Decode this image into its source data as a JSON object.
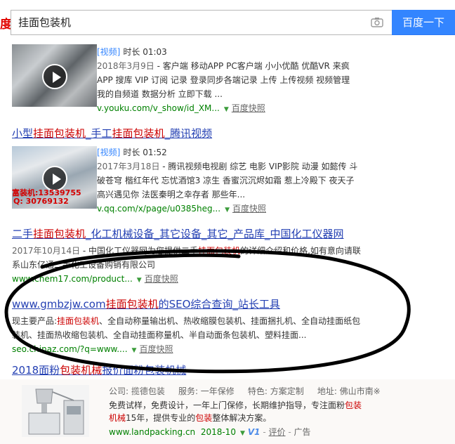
{
  "search": {
    "logo_fragment": "度",
    "query": "挂面包装机",
    "button": "百度一下"
  },
  "results": [
    {
      "tag": "[视频]",
      "duration": "时长 01:03",
      "date": "2018年3月9日",
      "line1": " - 客户端 移动APP PC客户端 小小优酷 优酷VR 来疯",
      "line2": "APP 搜库 VIP 订阅 记录 登录同步各端记录 上传 上传视频 视频管理",
      "line3": "我的自频道 数据分析 立即下载 ...",
      "url": "v.youku.com/v_show/id_XM...",
      "snapshot": "百度快照"
    },
    {
      "title_a": "小型",
      "title_em1": "挂面包装机",
      "title_b": "_手工",
      "title_em2": "挂面包装机",
      "title_c": "_腾讯视频",
      "tag": "[视频]",
      "duration": "时长 01:52",
      "date": "2017年3月18日",
      "line1": " - 腾讯视频电视剧 综艺 电影 VIP影院 动漫 如懿传 斗",
      "line2": "破苍穹 楷红年代 忘忧酒馆3 凉生 香蜜沉沉烬如霜 惹上冷殿下 夜天子",
      "line3": "高兴遇见你 法医秦明之幸存者 那些年...",
      "url": "v.qq.com/x/page/u0385heg...",
      "snapshot": "百度快照",
      "thumb_text": "富装机:13539755",
      "thumb_text2": "Q: 30769132"
    },
    {
      "title_a": "二手",
      "title_em1": "挂面包装机",
      "title_b": "_化工机械设备_其它设备_其它_产品库_中国化工仪器网",
      "date": "2017年10月14日",
      "abs_a": " - 中国化工仪器网为您提供二手",
      "abs_em": "挂面包装机",
      "abs_b": "的详细介绍和价格,如有意向请联",
      "abs_line2": "系山东亿通二手化工设备购销有限公司",
      "url": "www.chem17.com/product...",
      "snapshot": "百度快照"
    },
    {
      "title_a": "www.gmbzjw.com",
      "title_em1": "挂面包装机",
      "title_b": "的SEO综合查询_站长工具",
      "abs_a": "现主要产品:",
      "abs_em": "挂面包装机",
      "abs_b": "、全自动称量输出机、热收缩膜包装机、挂面捆扎机、全自动挂面纸包",
      "abs_line2": "装机、挂面热收缩包装机、全自动挂面称量机、半自动面条包装机、塑料挂面...",
      "url": "seo.chinaz.com/?q=www....",
      "snapshot": "百度快照"
    }
  ],
  "ad": {
    "title_a": "2018面粉",
    "title_em1": "包装机械",
    "title_b": "报价面粉包装机械",
    "company": "公司: 揽德包装",
    "service": "服务: 一年保修",
    "feature": "特色: 方案定制",
    "address": "地址: 佛山市南※",
    "desc1_a": "免费试样，免费设计，一年上门保修，长期维护指导，专注面粉",
    "desc1_em": "包装",
    "desc2_em": "机械",
    "desc2_a": "15年，提供专业的",
    "desc2_em2": "包装",
    "desc2_b": "整体解决方案。",
    "url": "www.landpacking.cn",
    "date": "2018-10",
    "v_badge": "V1",
    "review": "评价",
    "label": "广告"
  }
}
